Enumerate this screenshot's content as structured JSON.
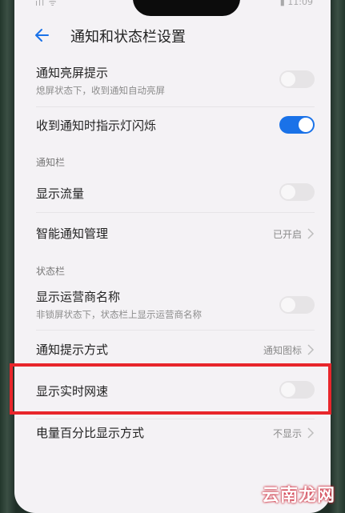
{
  "statusbar": {
    "left": "ıll ᯤ",
    "right": "▮ 11:09"
  },
  "header": {
    "title": "通知和状态栏设置"
  },
  "items": {
    "notify_wake": {
      "title": "通知亮屏提示",
      "subtitle": "熄屏状态下，收到通知自动亮屏",
      "toggle": false
    },
    "notify_led": {
      "title": "收到通知时指示灯闪烁",
      "toggle": true
    },
    "section_notify": "通知栏",
    "show_traffic": {
      "title": "显示流量",
      "toggle": false
    },
    "smart_notify": {
      "title": "智能通知管理",
      "value": "已开启"
    },
    "section_status": "状态栏",
    "show_carrier": {
      "title": "显示运营商名称",
      "subtitle": "非锁屏状态下，状态栏上显示运营商名称",
      "toggle": false
    },
    "notify_style": {
      "title": "通知提示方式",
      "value": "通知图标"
    },
    "show_speed": {
      "title": "显示实时网速",
      "toggle": false
    },
    "battery_pct": {
      "title": "电量百分比显示方式",
      "value": "不显示"
    }
  },
  "watermark": "云南龙网",
  "colors": {
    "accent": "#1a72e8",
    "highlight": "#e8262b"
  }
}
